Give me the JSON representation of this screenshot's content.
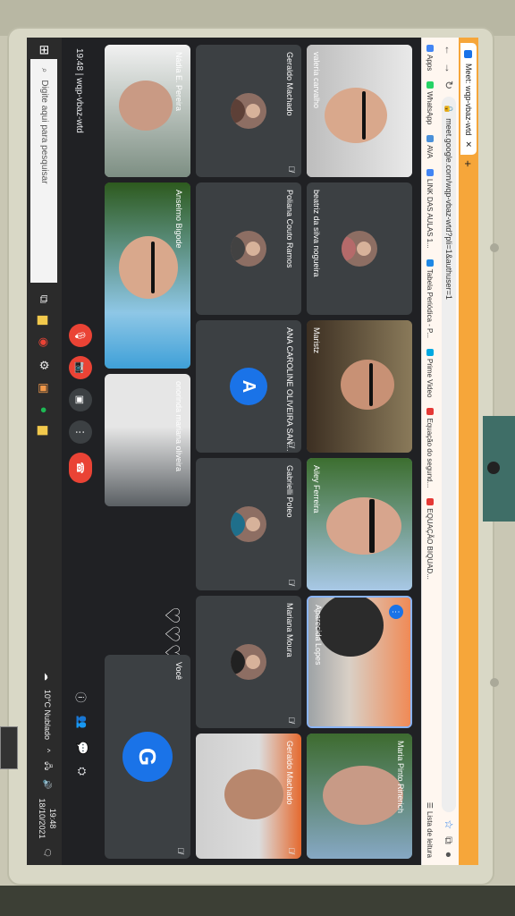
{
  "browser": {
    "tab_title": "Meet: wqp-vbaz-wtd",
    "url": "meet.google.com/wqp-vbaz-wtd?pli=1&authuser=1",
    "bookmarks": [
      "Apps",
      "WhatsApp",
      "AVA",
      "LINK DAS AULAS 1...",
      "Tabela Periódica - P...",
      "Prime Video",
      "Equação do segund...",
      "EQUAÇÃO BIQUAD..."
    ],
    "reading_list": "Lista de leitura",
    "bookmark_colors": [
      "#4285f4",
      "#25d366",
      "#4a90d9",
      "#4285f4",
      "#1e88e5",
      "#00a8e1",
      "#e53935",
      "#e53935"
    ]
  },
  "meet": {
    "time_code": "19:48 | wqp-vbaz-wtd",
    "participants": [
      {
        "name": "valeria carvalho",
        "type": "video"
      },
      {
        "name": "Geraldo Machado",
        "type": "avatar"
      },
      {
        "name": "Nádia E. Pereira",
        "type": "video"
      },
      {
        "name": "beatriz da silva nogueira",
        "type": "avatar"
      },
      {
        "name": "Poliana Couto Ramos",
        "type": "avatar"
      },
      {
        "name": "Maristz",
        "type": "video"
      },
      {
        "name": "ANA CAROLINE OLIVEIRA SAN...",
        "type": "letter",
        "letter": "A"
      },
      {
        "name": "Anselmo Bigode",
        "type": "video"
      },
      {
        "name": "Ailey Ferreira",
        "type": "video"
      },
      {
        "name": "Gabrielli Poleo",
        "type": "avatar"
      },
      {
        "name": "onorinda mariana oliveira",
        "type": "video"
      },
      {
        "name": "Aparecida Lopes",
        "type": "video"
      },
      {
        "name": "Mariana Moura",
        "type": "avatar"
      },
      {
        "name": "Maria Pinto Rinerich",
        "type": "video"
      },
      {
        "name": "Geraldo Machado",
        "type": "video"
      },
      {
        "name": "Você",
        "type": "letter",
        "letter": "G"
      }
    ],
    "hearts": "♡♡♡♡♡",
    "accent": "#1a73e8",
    "hangup_color": "#ea4335"
  },
  "taskbar": {
    "search_placeholder": "Digite aqui para pesquisar",
    "weather": "10°C  Nublado",
    "time": "19:48",
    "date": "18/10/2021"
  }
}
